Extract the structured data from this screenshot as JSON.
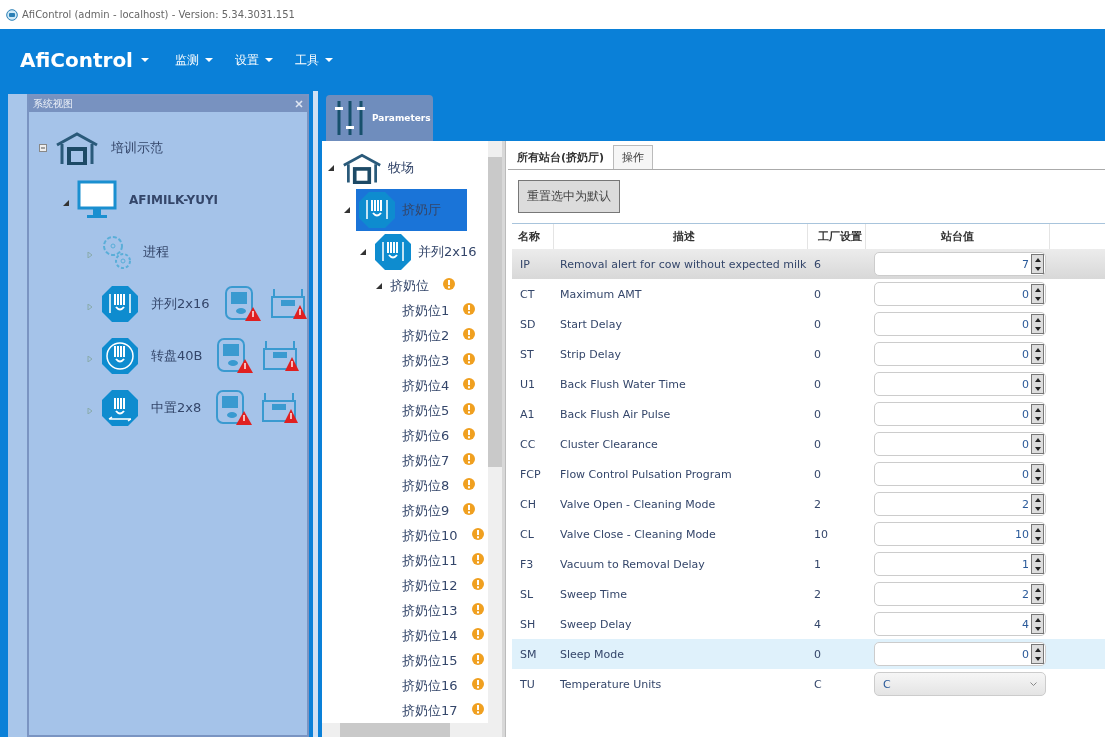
{
  "window": {
    "title": "AfiControl (admin - localhost) - Version: 5.34.3031.151"
  },
  "menu": {
    "brand": "AfiControl",
    "items": [
      "监测",
      "设置",
      "工具"
    ]
  },
  "system_view": {
    "title": "系统视图",
    "tree": [
      {
        "label": "培训示范",
        "expanded": true,
        "children": [
          {
            "label": "AFIMILK-YUYI",
            "expanded": true,
            "children": [
              {
                "label": "进程",
                "expanded": false,
                "alerts": false
              },
              {
                "label": "并列2x16",
                "expanded": false,
                "alerts": true
              },
              {
                "label": "转盘40B",
                "expanded": false,
                "alerts": true
              },
              {
                "label": "中置2x8",
                "expanded": false,
                "alerts": true
              }
            ]
          }
        ]
      }
    ]
  },
  "parameters_tab": {
    "label": "Parameters"
  },
  "parlor_tree": [
    {
      "label": "牧场",
      "selected": false,
      "warning": false,
      "children": [
        {
          "label": "挤奶厅",
          "selected": true,
          "warning": false,
          "children": [
            {
              "label": "并列2x16",
              "selected": false,
              "warning": false,
              "children": [
                {
                  "label": "挤奶位",
                  "selected": false,
                  "warning": true,
                  "children": [
                    {
                      "label": "挤奶位1",
                      "selected": false,
                      "warning": true
                    },
                    {
                      "label": "挤奶位2",
                      "selected": false,
                      "warning": true
                    },
                    {
                      "label": "挤奶位3",
                      "selected": false,
                      "warning": true
                    },
                    {
                      "label": "挤奶位4",
                      "selected": false,
                      "warning": true
                    },
                    {
                      "label": "挤奶位5",
                      "selected": false,
                      "warning": true
                    },
                    {
                      "label": "挤奶位6",
                      "selected": false,
                      "warning": true
                    },
                    {
                      "label": "挤奶位7",
                      "selected": false,
                      "warning": true
                    },
                    {
                      "label": "挤奶位8",
                      "selected": false,
                      "warning": true
                    },
                    {
                      "label": "挤奶位9",
                      "selected": false,
                      "warning": true
                    },
                    {
                      "label": "挤奶位10",
                      "selected": false,
                      "warning": true
                    },
                    {
                      "label": "挤奶位11",
                      "selected": false,
                      "warning": true
                    },
                    {
                      "label": "挤奶位12",
                      "selected": false,
                      "warning": true
                    },
                    {
                      "label": "挤奶位13",
                      "selected": false,
                      "warning": true
                    },
                    {
                      "label": "挤奶位14",
                      "selected": false,
                      "warning": true
                    },
                    {
                      "label": "挤奶位15",
                      "selected": false,
                      "warning": true
                    },
                    {
                      "label": "挤奶位16",
                      "selected": false,
                      "warning": true
                    },
                    {
                      "label": "挤奶位17",
                      "selected": false,
                      "warning": true
                    }
                  ]
                }
              ]
            }
          ]
        }
      ]
    }
  ],
  "tabs": [
    {
      "label": "所有站台(挤奶厅)",
      "selected": true
    },
    {
      "label": "操作",
      "selected": false
    }
  ],
  "reset_button": "重置选中为默认",
  "table": {
    "columns": [
      "名称",
      "描述",
      "工厂设置",
      "站台值"
    ],
    "rows": [
      {
        "name": "IP",
        "description": "Removal alert for cow without expected milk",
        "factory": "6",
        "value": "7",
        "kind": "spinner",
        "selected": true,
        "hovered": false
      },
      {
        "name": "CT",
        "description": "Maximum AMT",
        "factory": "0",
        "value": "0",
        "kind": "spinner",
        "selected": false,
        "hovered": false
      },
      {
        "name": "SD",
        "description": "Start Delay",
        "factory": "0",
        "value": "0",
        "kind": "spinner",
        "selected": false,
        "hovered": false
      },
      {
        "name": "ST",
        "description": "Strip Delay",
        "factory": "0",
        "value": "0",
        "kind": "spinner",
        "selected": false,
        "hovered": false
      },
      {
        "name": "U1",
        "description": "Back Flush Water Time",
        "factory": "0",
        "value": "0",
        "kind": "spinner",
        "selected": false,
        "hovered": false
      },
      {
        "name": "A1",
        "description": "Back Flush Air Pulse",
        "factory": "0",
        "value": "0",
        "kind": "spinner",
        "selected": false,
        "hovered": false
      },
      {
        "name": "CC",
        "description": "Cluster Clearance",
        "factory": "0",
        "value": "0",
        "kind": "spinner",
        "selected": false,
        "hovered": false
      },
      {
        "name": "FCP",
        "description": "Flow Control Pulsation Program",
        "factory": "0",
        "value": "0",
        "kind": "spinner",
        "selected": false,
        "hovered": false
      },
      {
        "name": "CH",
        "description": "Valve Open - Cleaning Mode",
        "factory": "2",
        "value": "2",
        "kind": "spinner",
        "selected": false,
        "hovered": false
      },
      {
        "name": "CL",
        "description": "Valve Close - Cleaning Mode",
        "factory": "10",
        "value": "10",
        "kind": "spinner",
        "selected": false,
        "hovered": false
      },
      {
        "name": "F3",
        "description": "Vacuum to Removal Delay",
        "factory": "1",
        "value": "1",
        "kind": "spinner",
        "selected": false,
        "hovered": false
      },
      {
        "name": "SL",
        "description": "Sweep Time",
        "factory": "2",
        "value": "2",
        "kind": "spinner",
        "selected": false,
        "hovered": false
      },
      {
        "name": "SH",
        "description": "Sweep Delay",
        "factory": "4",
        "value": "4",
        "kind": "spinner",
        "selected": false,
        "hovered": false
      },
      {
        "name": "SM",
        "description": "Sleep Mode",
        "factory": "0",
        "value": "0",
        "kind": "spinner",
        "selected": false,
        "hovered": true
      },
      {
        "name": "TU",
        "description": "Temperature Units",
        "factory": "C",
        "value": "C",
        "kind": "dropdown",
        "selected": false,
        "hovered": false
      }
    ]
  }
}
